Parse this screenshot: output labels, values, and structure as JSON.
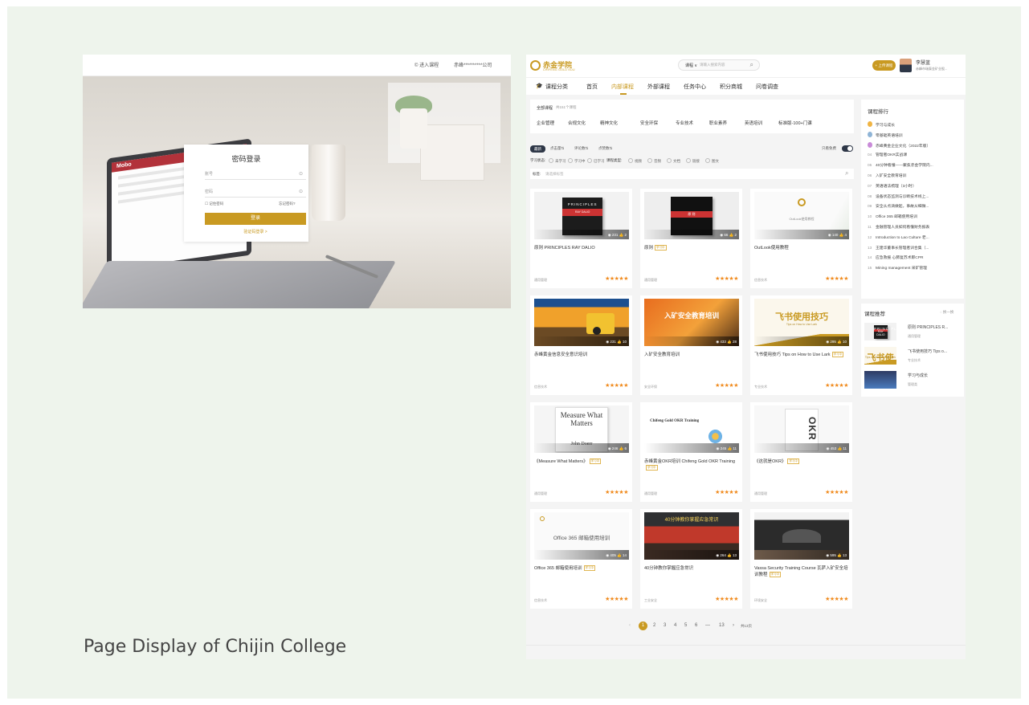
{
  "caption": "Page Display of Chijin College",
  "login_screen": {
    "topbar": {
      "item1": "© 进入课程",
      "item2": "赤峰**********公司"
    },
    "laptop_logo": "Mobo",
    "card": {
      "title": "密码登录",
      "username_placeholder": "账号",
      "password_placeholder": "密码",
      "remember": "记住密码",
      "forget": "忘记密码?",
      "login_button": "登录",
      "switch_link": "验证码登录 >"
    }
  },
  "course_screen": {
    "logo": {
      "name": "赤金学院",
      "sub": "CHIFENG GOLD EDU"
    },
    "search": {
      "type": "课程 ∨",
      "placeholder": "请输入搜索内容"
    },
    "upload_button": "+ 上传课程",
    "user": {
      "name": "李慧蓝",
      "org": "赤峰市瑞泰金矿业股..."
    },
    "nav": {
      "category": "课程分类",
      "items": [
        "首页",
        "内部课程",
        "外部课程",
        "任务中心",
        "积分商城",
        "问卷调查"
      ],
      "active": "内部课程"
    },
    "filter": {
      "all": "全部课程",
      "count": "共151个课程",
      "categories": [
        "企业管理",
        "合规文化",
        "精神文化",
        "安全环保",
        "专业技术",
        "职业素养",
        "英语培训",
        "标准版-100+门课"
      ]
    },
    "sort": {
      "active": "最新",
      "options": [
        "点击量⇅",
        "评论数⇅",
        "点赞数⇅"
      ],
      "toggle_label": "只看免费"
    },
    "status": {
      "study_label": "学习状态:",
      "study_options": [
        "未学习",
        "学习中",
        "已学习"
      ],
      "type_label": "课程类型:",
      "type_options": [
        "视频",
        "音频",
        "文档",
        "链接",
        "图文"
      ]
    },
    "tags": {
      "label": "标签:",
      "placeholder": "请选择标签"
    },
    "courses": [
      {
        "title": "原则 PRINCIPLES RAY DALIO",
        "badge": "",
        "category": "通用管理",
        "stats": "◉ 231  👍 2",
        "thumb": "book-principles"
      },
      {
        "title": "原则",
        "badge": "学习中",
        "category": "通用管理",
        "stats": "◉ 66  👍 2",
        "thumb": "book-dark"
      },
      {
        "title": "OutLook使用教程",
        "badge": "",
        "category": "信息技术",
        "stats": "◉ 140  👍 4",
        "thumb": "outlook"
      },
      {
        "title": "赤峰黄金信息安全意识培训",
        "badge": "",
        "category": "信息技术",
        "stats": "◉ 231  👍 10",
        "thumb": "mining-truck"
      },
      {
        "title": "入矿安全教育培训",
        "badge": "",
        "category": "安全环保",
        "stats": "◉ 433  👍 28",
        "thumb": "safety"
      },
      {
        "title": "飞书使用技巧 Tips on How to Use Lark",
        "badge": "学习中",
        "category": "专业技术",
        "stats": "◉ 295  👍 10",
        "thumb": "lark"
      },
      {
        "title": "《Measure What Matters》",
        "badge": "学习中",
        "category": "通用管理",
        "stats": "◉ 246  👍 6",
        "thumb": "measure"
      },
      {
        "title": "赤峰黄金OKR培训 Chifeng Gold OKR Training",
        "badge": "学习中",
        "category": "通用管理",
        "stats": "◉ 245  👍 11",
        "thumb": "okr-training"
      },
      {
        "title": "《这就是OKR》",
        "badge": "学习中",
        "category": "通用管理",
        "stats": "◉ 453  👍 11",
        "thumb": "okr-book"
      },
      {
        "title": "Office 365 邮箱使用培训",
        "badge": "学习中",
        "category": "信息技术",
        "stats": "◉ 405  👍 14",
        "thumb": "office"
      },
      {
        "title": "40分钟教你掌握应急常识",
        "badge": "",
        "category": "工业安全",
        "stats": "◉ 264  👍 13",
        "thumb": "emergency"
      },
      {
        "title": "Vassa Security Training Course 瓦萨入矿安全培训教程",
        "badge": "学习中",
        "category": "环境安全",
        "stats": "◉ 595  👍 13",
        "thumb": "vassa"
      }
    ],
    "thumb_texts": {
      "principles_book": "PRINCIPLES",
      "principles_author": "RAY DALIO",
      "dark_book": "原 则",
      "outlook": "OutLook使用教程",
      "safety": "入矿安全教育培训",
      "lark": "飞书使用技巧",
      "lark_sub": "Tips on How to Use Lark",
      "measure": "Measure What Matters",
      "measure_author": "John Doerr",
      "okr_training": "Chifeng Gold OKR Training",
      "okr_book": "OKR",
      "office": "Office 365 邮箱使用培训",
      "emergency": "40分钟教你掌握应急常识"
    },
    "pagination": {
      "pages": [
        "1",
        "2",
        "3",
        "4",
        "5",
        "6",
        "—",
        "13"
      ],
      "current": "1",
      "total": "共13页"
    },
    "ranking": {
      "title": "课程排行",
      "items": [
        {
          "num": "",
          "medal": "#f0b443",
          "label": "学习与成长"
        },
        {
          "num": "",
          "medal": "#8fb4d6",
          "label": "零基础英语培训"
        },
        {
          "num": "",
          "medal": "#c98bd8",
          "label": "赤峰黄金企业文化（2022年版）"
        },
        {
          "num": "04",
          "medal": "",
          "label": "管理者OKR实战课"
        },
        {
          "num": "05",
          "medal": "",
          "label": "40分钟看懂——聚焦赤金学院内..."
        },
        {
          "num": "06",
          "medal": "",
          "label": "入矿安全教育培训"
        },
        {
          "num": "07",
          "medal": "",
          "label": "英语语法梳理（3小时）"
        },
        {
          "num": "08",
          "medal": "",
          "label": "设备状态监测与诊断技术线上..."
        },
        {
          "num": "09",
          "medal": "",
          "label": "安全从点滴做起，事故从细微..."
        },
        {
          "num": "10",
          "medal": "",
          "label": "Office 365 邮箱使用培训"
        },
        {
          "num": "11",
          "medal": "",
          "label": "金融管理人员如何看懂财务报表"
        },
        {
          "num": "12",
          "medal": "",
          "label": "Introduction to Lao Culture 老..."
        },
        {
          "num": "13",
          "medal": "",
          "label": "王建华董事长管理者训合集（..."
        },
        {
          "num": "14",
          "medal": "",
          "label": "应急救援 心肺复苏术即CPR"
        },
        {
          "num": "15",
          "medal": "",
          "label": "Mining management 采矿管理"
        }
      ]
    },
    "recommend": {
      "title": "课程推荐",
      "refresh": "◌ 换一换",
      "items": [
        {
          "name": "原则 PRINCIPLES R...",
          "category": "通用管理",
          "thumb": "book-principles"
        },
        {
          "name": "飞书使用技巧 Tips o...",
          "category": "专业技术",
          "thumb": "lark"
        },
        {
          "name": "学习与成长",
          "category": "管理类",
          "thumb": "growth"
        }
      ]
    },
    "colors": {
      "accent": "#c99a22",
      "stars": "#f08a1c",
      "dark": "#2e3747"
    }
  }
}
